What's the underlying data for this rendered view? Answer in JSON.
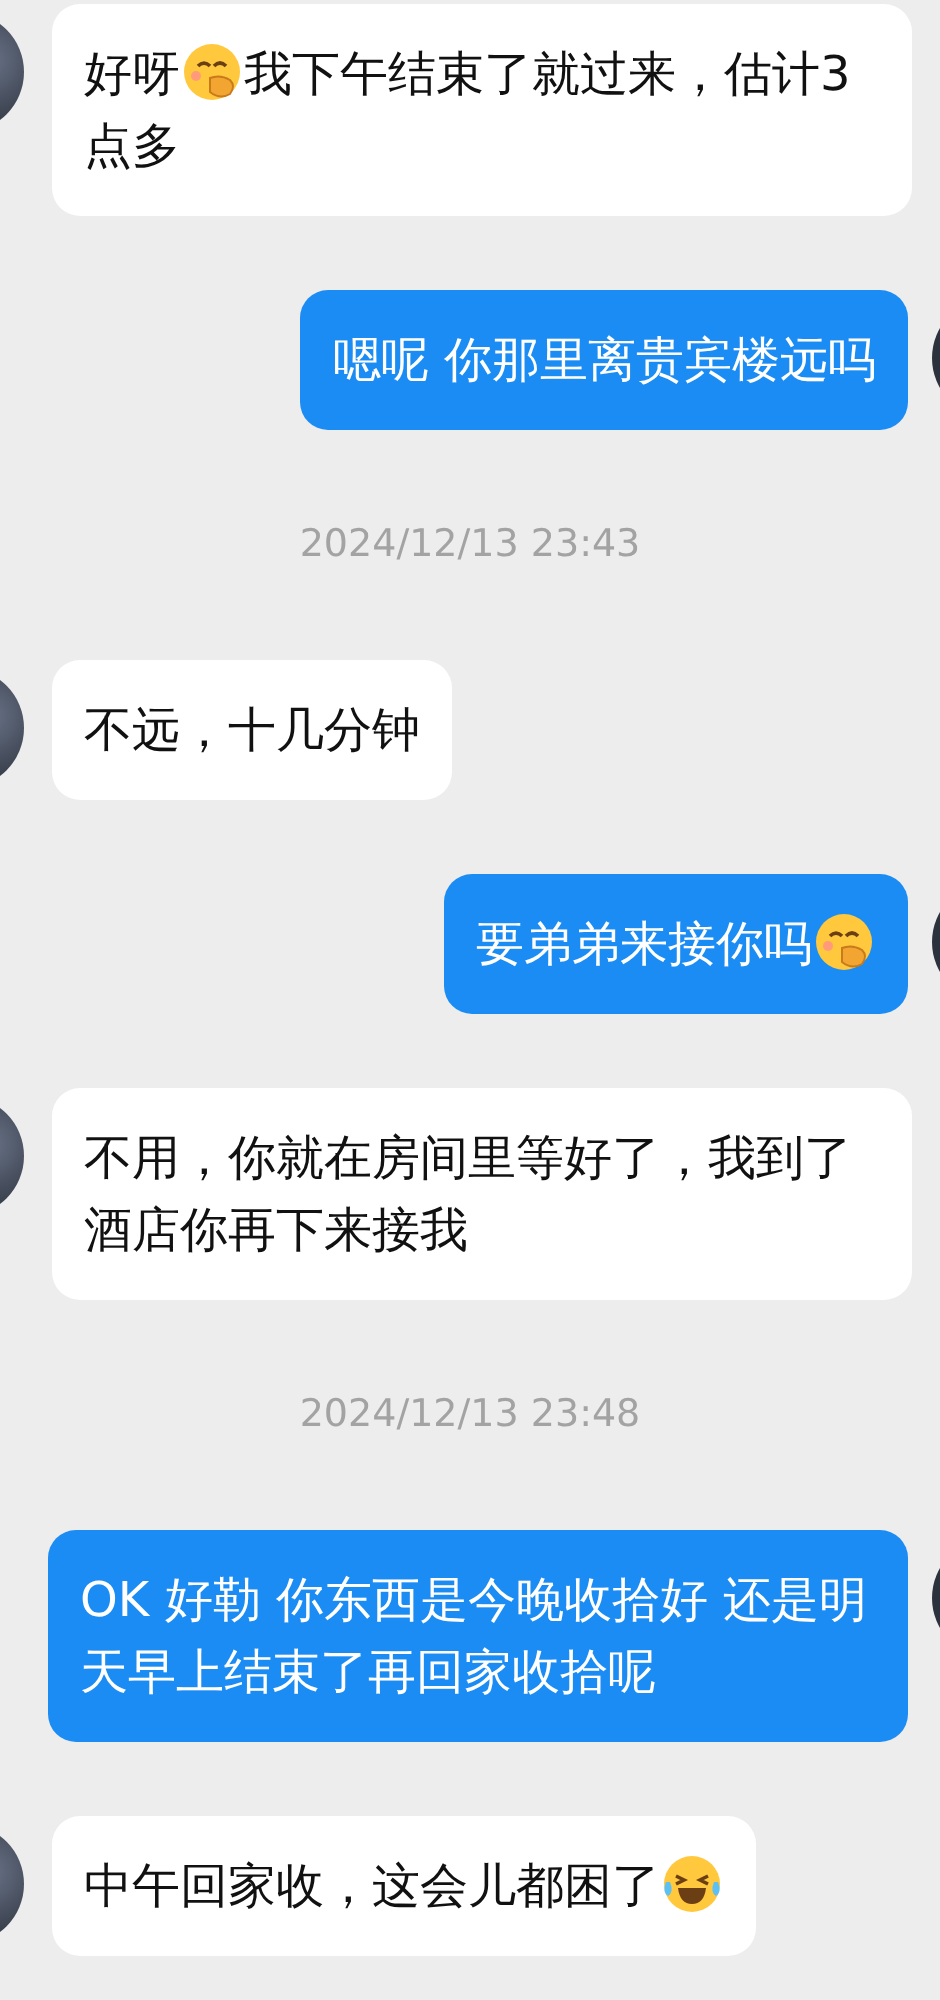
{
  "messages": [
    {
      "kind": "incoming",
      "parts": [
        {
          "kind": "text",
          "text": "好呀"
        },
        {
          "kind": "shy-emoji"
        },
        {
          "kind": "text",
          "text": "我下午结束了就过来，估计3点多"
        }
      ]
    },
    {
      "kind": "outgoing",
      "parts": [
        {
          "kind": "text",
          "text": "嗯呢 你那里离贵宾楼远吗"
        }
      ]
    },
    {
      "kind": "time",
      "text": "2024/12/13 23:43"
    },
    {
      "kind": "incoming",
      "parts": [
        {
          "kind": "text",
          "text": "不远，十几分钟"
        }
      ]
    },
    {
      "kind": "outgoing",
      "parts": [
        {
          "kind": "text",
          "text": "要弟弟来接你吗"
        },
        {
          "kind": "shy-emoji"
        }
      ]
    },
    {
      "kind": "incoming",
      "parts": [
        {
          "kind": "text",
          "text": "不用，你就在房间里等好了，我到了酒店你再下来接我"
        }
      ]
    },
    {
      "kind": "time",
      "text": "2024/12/13 23:48"
    },
    {
      "kind": "outgoing",
      "parts": [
        {
          "kind": "text",
          "text": "OK 好勒 你东西是今晚收拾好 还是明天早上结束了再回家收拾呢"
        }
      ]
    },
    {
      "kind": "incoming",
      "parts": [
        {
          "kind": "text",
          "text": "中午回家收，这会儿都困了"
        },
        {
          "kind": "laugh-emoji"
        }
      ]
    }
  ]
}
